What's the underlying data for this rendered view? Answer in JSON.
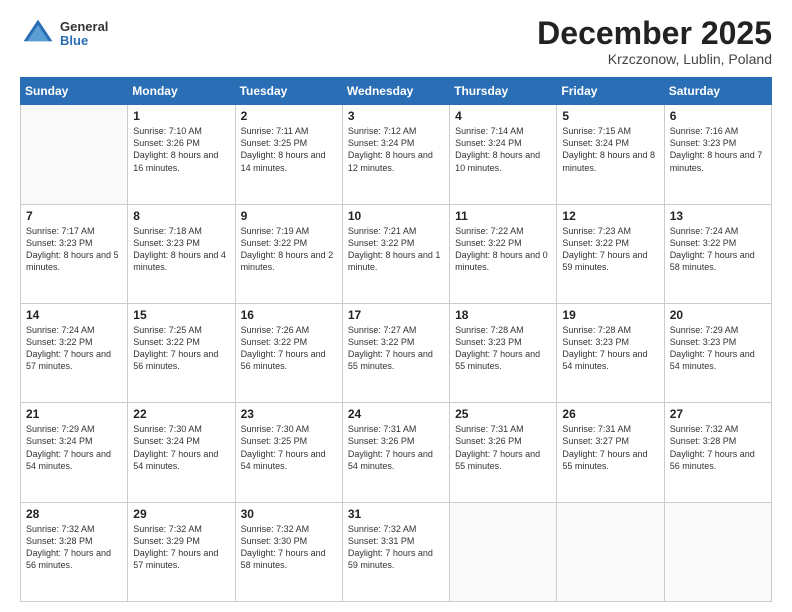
{
  "header": {
    "logo": {
      "general": "General",
      "blue": "Blue"
    },
    "title": "December 2025",
    "location": "Krzczonow, Lublin, Poland"
  },
  "weekdays": [
    "Sunday",
    "Monday",
    "Tuesday",
    "Wednesday",
    "Thursday",
    "Friday",
    "Saturday"
  ],
  "weeks": [
    [
      {
        "num": "",
        "empty": true
      },
      {
        "num": "1",
        "sunrise": "Sunrise: 7:10 AM",
        "sunset": "Sunset: 3:26 PM",
        "daylight": "Daylight: 8 hours and 16 minutes."
      },
      {
        "num": "2",
        "sunrise": "Sunrise: 7:11 AM",
        "sunset": "Sunset: 3:25 PM",
        "daylight": "Daylight: 8 hours and 14 minutes."
      },
      {
        "num": "3",
        "sunrise": "Sunrise: 7:12 AM",
        "sunset": "Sunset: 3:24 PM",
        "daylight": "Daylight: 8 hours and 12 minutes."
      },
      {
        "num": "4",
        "sunrise": "Sunrise: 7:14 AM",
        "sunset": "Sunset: 3:24 PM",
        "daylight": "Daylight: 8 hours and 10 minutes."
      },
      {
        "num": "5",
        "sunrise": "Sunrise: 7:15 AM",
        "sunset": "Sunset: 3:24 PM",
        "daylight": "Daylight: 8 hours and 8 minutes."
      },
      {
        "num": "6",
        "sunrise": "Sunrise: 7:16 AM",
        "sunset": "Sunset: 3:23 PM",
        "daylight": "Daylight: 8 hours and 7 minutes."
      }
    ],
    [
      {
        "num": "7",
        "sunrise": "Sunrise: 7:17 AM",
        "sunset": "Sunset: 3:23 PM",
        "daylight": "Daylight: 8 hours and 5 minutes."
      },
      {
        "num": "8",
        "sunrise": "Sunrise: 7:18 AM",
        "sunset": "Sunset: 3:23 PM",
        "daylight": "Daylight: 8 hours and 4 minutes."
      },
      {
        "num": "9",
        "sunrise": "Sunrise: 7:19 AM",
        "sunset": "Sunset: 3:22 PM",
        "daylight": "Daylight: 8 hours and 2 minutes."
      },
      {
        "num": "10",
        "sunrise": "Sunrise: 7:21 AM",
        "sunset": "Sunset: 3:22 PM",
        "daylight": "Daylight: 8 hours and 1 minute."
      },
      {
        "num": "11",
        "sunrise": "Sunrise: 7:22 AM",
        "sunset": "Sunset: 3:22 PM",
        "daylight": "Daylight: 8 hours and 0 minutes."
      },
      {
        "num": "12",
        "sunrise": "Sunrise: 7:23 AM",
        "sunset": "Sunset: 3:22 PM",
        "daylight": "Daylight: 7 hours and 59 minutes."
      },
      {
        "num": "13",
        "sunrise": "Sunrise: 7:24 AM",
        "sunset": "Sunset: 3:22 PM",
        "daylight": "Daylight: 7 hours and 58 minutes."
      }
    ],
    [
      {
        "num": "14",
        "sunrise": "Sunrise: 7:24 AM",
        "sunset": "Sunset: 3:22 PM",
        "daylight": "Daylight: 7 hours and 57 minutes."
      },
      {
        "num": "15",
        "sunrise": "Sunrise: 7:25 AM",
        "sunset": "Sunset: 3:22 PM",
        "daylight": "Daylight: 7 hours and 56 minutes."
      },
      {
        "num": "16",
        "sunrise": "Sunrise: 7:26 AM",
        "sunset": "Sunset: 3:22 PM",
        "daylight": "Daylight: 7 hours and 56 minutes."
      },
      {
        "num": "17",
        "sunrise": "Sunrise: 7:27 AM",
        "sunset": "Sunset: 3:22 PM",
        "daylight": "Daylight: 7 hours and 55 minutes."
      },
      {
        "num": "18",
        "sunrise": "Sunrise: 7:28 AM",
        "sunset": "Sunset: 3:23 PM",
        "daylight": "Daylight: 7 hours and 55 minutes."
      },
      {
        "num": "19",
        "sunrise": "Sunrise: 7:28 AM",
        "sunset": "Sunset: 3:23 PM",
        "daylight": "Daylight: 7 hours and 54 minutes."
      },
      {
        "num": "20",
        "sunrise": "Sunrise: 7:29 AM",
        "sunset": "Sunset: 3:23 PM",
        "daylight": "Daylight: 7 hours and 54 minutes."
      }
    ],
    [
      {
        "num": "21",
        "sunrise": "Sunrise: 7:29 AM",
        "sunset": "Sunset: 3:24 PM",
        "daylight": "Daylight: 7 hours and 54 minutes."
      },
      {
        "num": "22",
        "sunrise": "Sunrise: 7:30 AM",
        "sunset": "Sunset: 3:24 PM",
        "daylight": "Daylight: 7 hours and 54 minutes."
      },
      {
        "num": "23",
        "sunrise": "Sunrise: 7:30 AM",
        "sunset": "Sunset: 3:25 PM",
        "daylight": "Daylight: 7 hours and 54 minutes."
      },
      {
        "num": "24",
        "sunrise": "Sunrise: 7:31 AM",
        "sunset": "Sunset: 3:26 PM",
        "daylight": "Daylight: 7 hours and 54 minutes."
      },
      {
        "num": "25",
        "sunrise": "Sunrise: 7:31 AM",
        "sunset": "Sunset: 3:26 PM",
        "daylight": "Daylight: 7 hours and 55 minutes."
      },
      {
        "num": "26",
        "sunrise": "Sunrise: 7:31 AM",
        "sunset": "Sunset: 3:27 PM",
        "daylight": "Daylight: 7 hours and 55 minutes."
      },
      {
        "num": "27",
        "sunrise": "Sunrise: 7:32 AM",
        "sunset": "Sunset: 3:28 PM",
        "daylight": "Daylight: 7 hours and 56 minutes."
      }
    ],
    [
      {
        "num": "28",
        "sunrise": "Sunrise: 7:32 AM",
        "sunset": "Sunset: 3:28 PM",
        "daylight": "Daylight: 7 hours and 56 minutes."
      },
      {
        "num": "29",
        "sunrise": "Sunrise: 7:32 AM",
        "sunset": "Sunset: 3:29 PM",
        "daylight": "Daylight: 7 hours and 57 minutes."
      },
      {
        "num": "30",
        "sunrise": "Sunrise: 7:32 AM",
        "sunset": "Sunset: 3:30 PM",
        "daylight": "Daylight: 7 hours and 58 minutes."
      },
      {
        "num": "31",
        "sunrise": "Sunrise: 7:32 AM",
        "sunset": "Sunset: 3:31 PM",
        "daylight": "Daylight: 7 hours and 59 minutes."
      },
      {
        "num": "",
        "empty": true
      },
      {
        "num": "",
        "empty": true
      },
      {
        "num": "",
        "empty": true
      }
    ]
  ]
}
